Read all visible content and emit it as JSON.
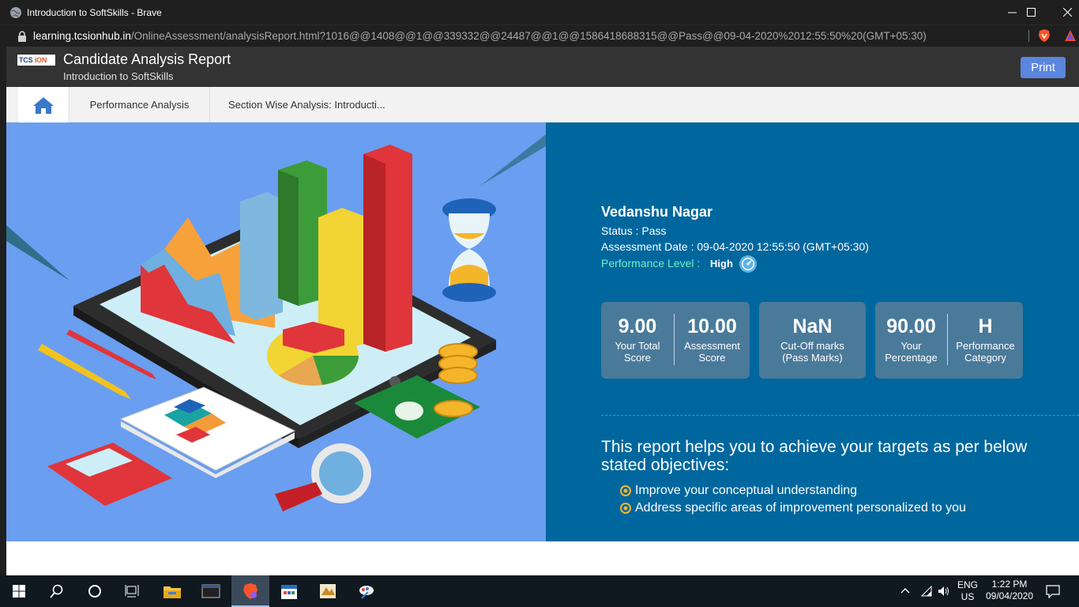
{
  "browser": {
    "window_title": "Introduction to SoftSkills - Brave",
    "url_host": "learning.tcsionhub.in",
    "url_path": "/OnlineAssessment/analysisReport.html?1016@@1408@@1@@339332@@24487@@1@@1586418688315@@Pass@@09-04-2020%2012:55:50%20(GMT+05:30)",
    "controls": [
      "—",
      "☐",
      "✕"
    ]
  },
  "header": {
    "logo_tcs": "TCS",
    "logo_ion": "iON",
    "title": "Candidate Analysis Report",
    "subtitle": "Introduction to SoftSkills",
    "print_label": "Print"
  },
  "nav": {
    "tabs": [
      {
        "label": "Performance Analysis"
      },
      {
        "label": "Section Wise Analysis: Introducti..."
      }
    ]
  },
  "candidate": {
    "name": "Vedanshu Nagar",
    "status": "Status : Pass",
    "assessment_date": "Assessment Date : 09-04-2020 12:55:50 (GMT+05:30)",
    "performance_label": "Performance Level :",
    "performance_value": "High"
  },
  "stats": [
    {
      "value": "9.00",
      "label_1": "Your Total",
      "label_2": "Score"
    },
    {
      "value": "10.00",
      "label_1": "Assessment",
      "label_2": "Score"
    },
    {
      "value": "NaN",
      "label_1": "Cut-Off marks",
      "label_2": "(Pass Marks)"
    },
    {
      "value": "90.00",
      "label_1": "Your",
      "label_2": "Percentage"
    },
    {
      "value": "H",
      "label_1": "Performance",
      "label_2": "Category"
    }
  ],
  "objectives": {
    "heading": "This report helps you to achieve your targets as per below stated objectives:",
    "items": [
      "Improve your conceptual understanding",
      "Address specific areas of improvement personalized to you"
    ]
  },
  "taskbar": {
    "lang_1": "ENG",
    "lang_2": "US",
    "time": "1:22 PM",
    "date": "09/04/2020"
  },
  "colors": {
    "hero_left": "#6a9ef0",
    "hero_right": "#00679e",
    "card": "#4a7a9a",
    "perf_label": "#6df0c8",
    "print_button": "#5b86e0"
  }
}
